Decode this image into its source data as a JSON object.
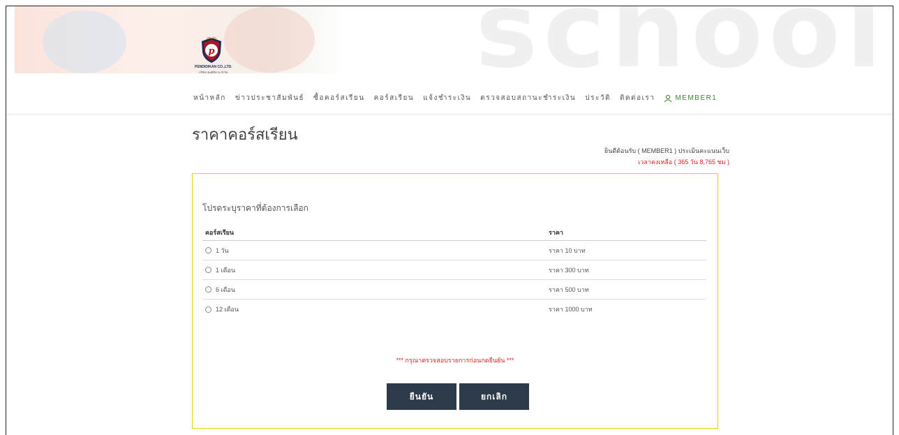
{
  "brand": {
    "logo_text": "PENDIDIKAN CO.,LTD.",
    "logo_sub": "บริษัท เพนดิดิคาน จำกัด",
    "watermark": "school",
    "logo_letter": "p"
  },
  "nav": {
    "items": [
      "หน้าหลัก",
      "ข่าวประชาสัมพันธ์",
      "ซื้อคอร์สเรียน",
      "คอร์สเรียน",
      "แจ้งชำระเงิน",
      "ตรวจสอบสถานะชำระเงิน",
      "ประวัติ",
      "ติดต่อเรา"
    ],
    "member_label": "MEMBER1"
  },
  "page": {
    "title": "ราคาคอร์สเรียน",
    "welcome": "ยินดีต้อนรับ ( MEMBER1 ) ประเมินคะแนนเว็บ",
    "remaining": "เวลาคงเหลือ ( 365 วัน 8,765 ชม )"
  },
  "panel": {
    "heading": "โปรดระบุราคาที่ต้องการเลือก",
    "columns": [
      "คอร์สเรียน",
      "ราคา"
    ],
    "rows": [
      {
        "course": "1 วัน",
        "price": "ราคา 10 บาท"
      },
      {
        "course": "1 เดือน",
        "price": "ราคา 300 บาท"
      },
      {
        "course": "6 เดือน",
        "price": "ราคา 500 บาท"
      },
      {
        "course": "12 เดือน",
        "price": "ราคา 1000 บาท"
      }
    ],
    "warning": "*** กรุณาตรวจสอบรายการก่อนกดยืนยัน ***",
    "confirm_label": "ยืนยัน",
    "cancel_label": "ยกเลิก"
  },
  "colors": {
    "accent_border": "#e6d600",
    "button_bg": "#2c3a4a",
    "warning": "#e02020",
    "member": "#3a8a2a"
  }
}
